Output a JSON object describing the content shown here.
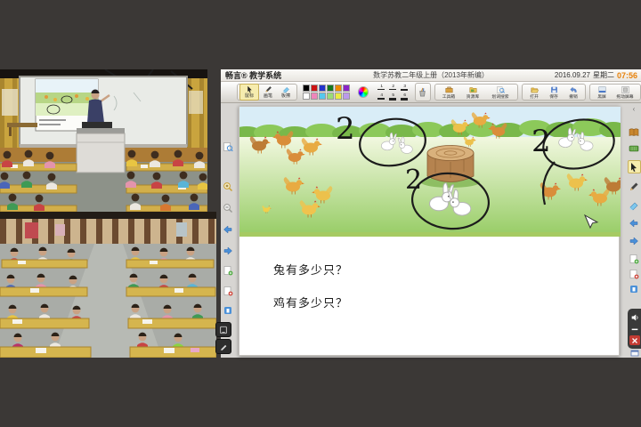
{
  "window": {
    "brand": "畅言® 教学系统",
    "doc_title": "数学苏教二年级上册（2013年新编）",
    "date": "2016.09.27",
    "weekday": "星期二",
    "time": "07:56",
    "time_color": "#e8820a"
  },
  "toolbar": {
    "tools": [
      {
        "label": "鼠标",
        "selected": true
      },
      {
        "label": "画笔",
        "selected": false
      },
      {
        "label": "板擦",
        "selected": false
      }
    ],
    "palette_colors": [
      "#000000",
      "#cc1414",
      "#2334cb",
      "#15781f",
      "#ee8a00",
      "#8a24c8",
      "#ffffff",
      "#ee86ba",
      "#55c8ee",
      "#9bdc78",
      "#ebeb45",
      "#bb9aeb"
    ],
    "thickness_options": [
      "1",
      "2",
      "3",
      "4",
      "5",
      "6"
    ],
    "actions": [
      {
        "label": "工具箱"
      },
      {
        "label": "资源库"
      },
      {
        "label": "划词搜索"
      },
      {
        "label": "打开"
      },
      {
        "label": "保存"
      },
      {
        "label": "撤销"
      },
      {
        "label": "黑屏"
      },
      {
        "label": "拖动屏幕"
      }
    ]
  },
  "canvas": {
    "ink_marks": [
      "2",
      "2",
      "2"
    ],
    "questions": [
      "兔有多少只？",
      "鸡有多少只？"
    ]
  }
}
